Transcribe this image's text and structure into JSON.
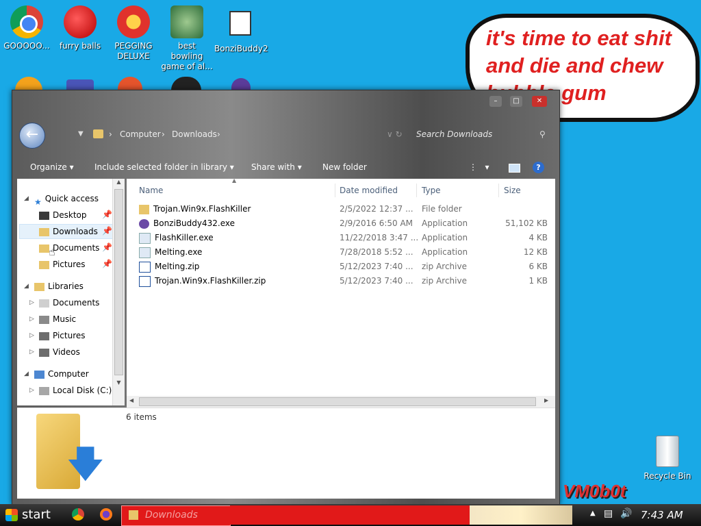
{
  "desktop": {
    "icons": [
      {
        "label": "GOOOOO..."
      },
      {
        "label": "furry balls"
      },
      {
        "label": "PEGGING DELUXE"
      },
      {
        "label": "best bowling game of al..."
      },
      {
        "label": "BonziBuddy2"
      }
    ],
    "recycle_bin": "Recycle Bin",
    "bubble_text": "it's time to eat shit and die and chew bubble gum",
    "watermark": "VM0b0t"
  },
  "window": {
    "address": [
      "Computer",
      "Downloads"
    ],
    "search_placeholder": "Search Downloads",
    "toolbar": {
      "organize": "Organize",
      "include": "Include selected folder in library",
      "share": "Share with",
      "new_folder": "New folder",
      "help": "?"
    },
    "nav": {
      "quick_access": "Quick access",
      "desktop": "Desktop",
      "downloads": "Downloads",
      "documents": "Documents",
      "pictures": "Pictures",
      "libraries": "Libraries",
      "lib_documents": "Documents",
      "music": "Music",
      "lib_pictures": "Pictures",
      "videos": "Videos",
      "computer": "Computer",
      "local_disk": "Local Disk (C:)"
    },
    "columns": {
      "name": "Name",
      "date": "Date modified",
      "type": "Type",
      "size": "Size"
    },
    "files": [
      {
        "name": "Trojan.Win9x.FlashKiller",
        "date": "2/5/2022 12:37 ...",
        "type": "File folder",
        "size": ""
      },
      {
        "name": "BonziBuddy432.exe",
        "date": "2/9/2016 6:50 AM",
        "type": "Application",
        "size": "51,102 KB"
      },
      {
        "name": "FlashKiller.exe",
        "date": "11/22/2018 3:47 ...",
        "type": "Application",
        "size": "4 KB"
      },
      {
        "name": "Melting.exe",
        "date": "7/28/2018 5:52 ...",
        "type": "Application",
        "size": "12 KB"
      },
      {
        "name": "Melting.zip",
        "date": "5/12/2023 7:40 ...",
        "type": "zip Archive",
        "size": "6 KB"
      },
      {
        "name": "Trojan.Win9x.FlashKiller.zip",
        "date": "5/12/2023 7:40 ...",
        "type": "zip Archive",
        "size": "1 KB"
      }
    ],
    "item_count": "6 items"
  },
  "taskbar": {
    "start": "start",
    "active_window": "Downloads",
    "clock": "7:43 AM"
  }
}
